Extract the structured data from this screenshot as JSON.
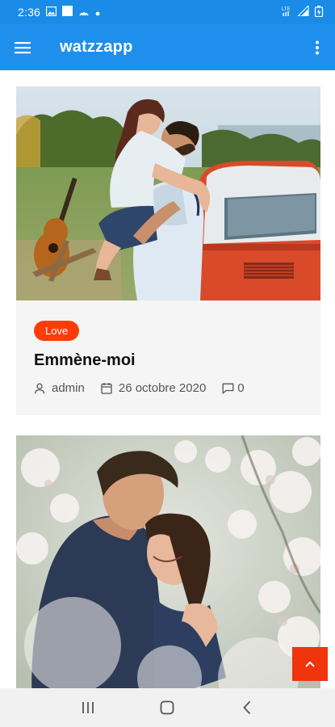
{
  "status_bar": {
    "time": "2:36",
    "lte_label": "LTE",
    "icons": [
      "image-icon",
      "square-icon",
      "hotspot-icon",
      "dot-icon",
      "lte-icon",
      "signal-icon",
      "battery-icon"
    ]
  },
  "app_bar": {
    "title": "watzzapp",
    "menu_icon": "hamburger-menu-icon",
    "more_icon": "more-vertical-icon",
    "color": "#1f8fee"
  },
  "posts": [
    {
      "tag": "Love",
      "title": "Emmène-moi",
      "author": "admin",
      "date": "26 octobre 2020",
      "comments": "0",
      "image": "couple-hugging-by-red-car-photo"
    },
    {
      "image": "couple-embracing-blossoms-photo"
    }
  ],
  "colors": {
    "accent": "#ff3b0a",
    "card_background": "#f5f5f6",
    "status_bar": "#1a8be6"
  },
  "scroll_top": {
    "icon": "chevron-up-icon"
  },
  "nav_bar": {
    "icons": [
      "recent-apps-icon",
      "home-icon",
      "back-icon"
    ]
  }
}
